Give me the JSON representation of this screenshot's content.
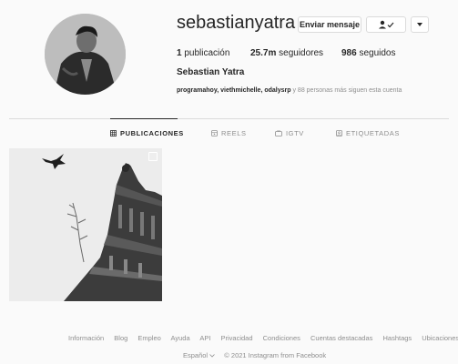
{
  "profile": {
    "username": "sebastianyatra",
    "full_name": "Sebastian Yatra",
    "verified": true,
    "message_button": "Enviar mensaje",
    "follow_status_icon": "person-check-icon",
    "dropdown_icon": "chevron-down-icon"
  },
  "stats": {
    "posts_count": "1",
    "posts_label": "publicación",
    "followers_count": "25.7m",
    "followers_label": "seguidores",
    "following_count": "986",
    "following_label": "seguidos"
  },
  "followed_by": {
    "names": "programahoy, viethmichelle, odalysrp",
    "more": "y 88 personas más siguen esta cuenta"
  },
  "tabs": [
    {
      "label": "PUBLICACIONES",
      "icon": "grid-icon",
      "active": true
    },
    {
      "label": "REELS",
      "icon": "reels-icon",
      "active": false
    },
    {
      "label": "IGTV",
      "icon": "igtv-icon",
      "active": false
    },
    {
      "label": "ETIQUETADAS",
      "icon": "tagged-icon",
      "active": false
    }
  ],
  "footer": {
    "links": [
      "Información",
      "Blog",
      "Empleo",
      "Ayuda",
      "API",
      "Privacidad",
      "Condiciones",
      "Cuentas destacadas",
      "Hashtags",
      "Ubicaciones"
    ],
    "language": "Español",
    "copyright": "© 2021 Instagram from Facebook"
  },
  "colors": {
    "background": "#fafafa",
    "text": "#262626",
    "muted": "#8e8e8e",
    "verified": "#3897f0",
    "border": "#dbdbdb"
  }
}
